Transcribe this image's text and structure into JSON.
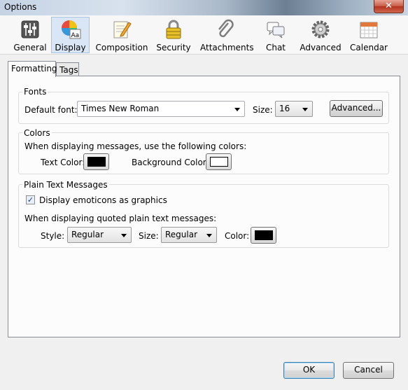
{
  "window": {
    "title": "Options",
    "close_glyph": "✕"
  },
  "toolbar": {
    "items": [
      {
        "label": "General",
        "icon": "sliders-icon"
      },
      {
        "label": "Display",
        "icon": "color-wheel-icon",
        "selected": true
      },
      {
        "label": "Composition",
        "icon": "pencil-paper-icon"
      },
      {
        "label": "Security",
        "icon": "padlock-icon"
      },
      {
        "label": "Attachments",
        "icon": "paperclip-icon"
      },
      {
        "label": "Chat",
        "icon": "chat-bubbles-icon"
      },
      {
        "label": "Advanced",
        "icon": "gear-icon"
      },
      {
        "label": "Calendar",
        "icon": "calendar-icon"
      }
    ]
  },
  "tabs": [
    {
      "label": "Formatting",
      "selected": true
    },
    {
      "label": "Tags",
      "selected": false
    }
  ],
  "fonts": {
    "group_title": "Fonts",
    "default_font_label_pre": "Default font:",
    "default_font_value": "Times New Roman",
    "size_label": "Size:",
    "size_value": "16",
    "advanced_button": "Advanced..."
  },
  "colors": {
    "group_title": "Colors",
    "description": "When displaying messages, use the following colors:",
    "text_color_label": "Text Color:",
    "text_color_value": "#000000",
    "background_color_label": "Background Color:",
    "background_color_value": "#ffffff"
  },
  "plain_text": {
    "group_title": "Plain Text Messages",
    "emoticons_checkbox_label": "Display emoticons as graphics",
    "emoticons_checked": true,
    "check_glyph": "✓",
    "quoted_description": "When displaying quoted plain text messages:",
    "style_label": "Style:",
    "style_value": "Regular",
    "size_label": "Size:",
    "size_value": "Regular",
    "color_label": "Color:",
    "color_value": "#000000"
  },
  "footer": {
    "ok_button": "OK",
    "cancel_button": "Cancel"
  }
}
